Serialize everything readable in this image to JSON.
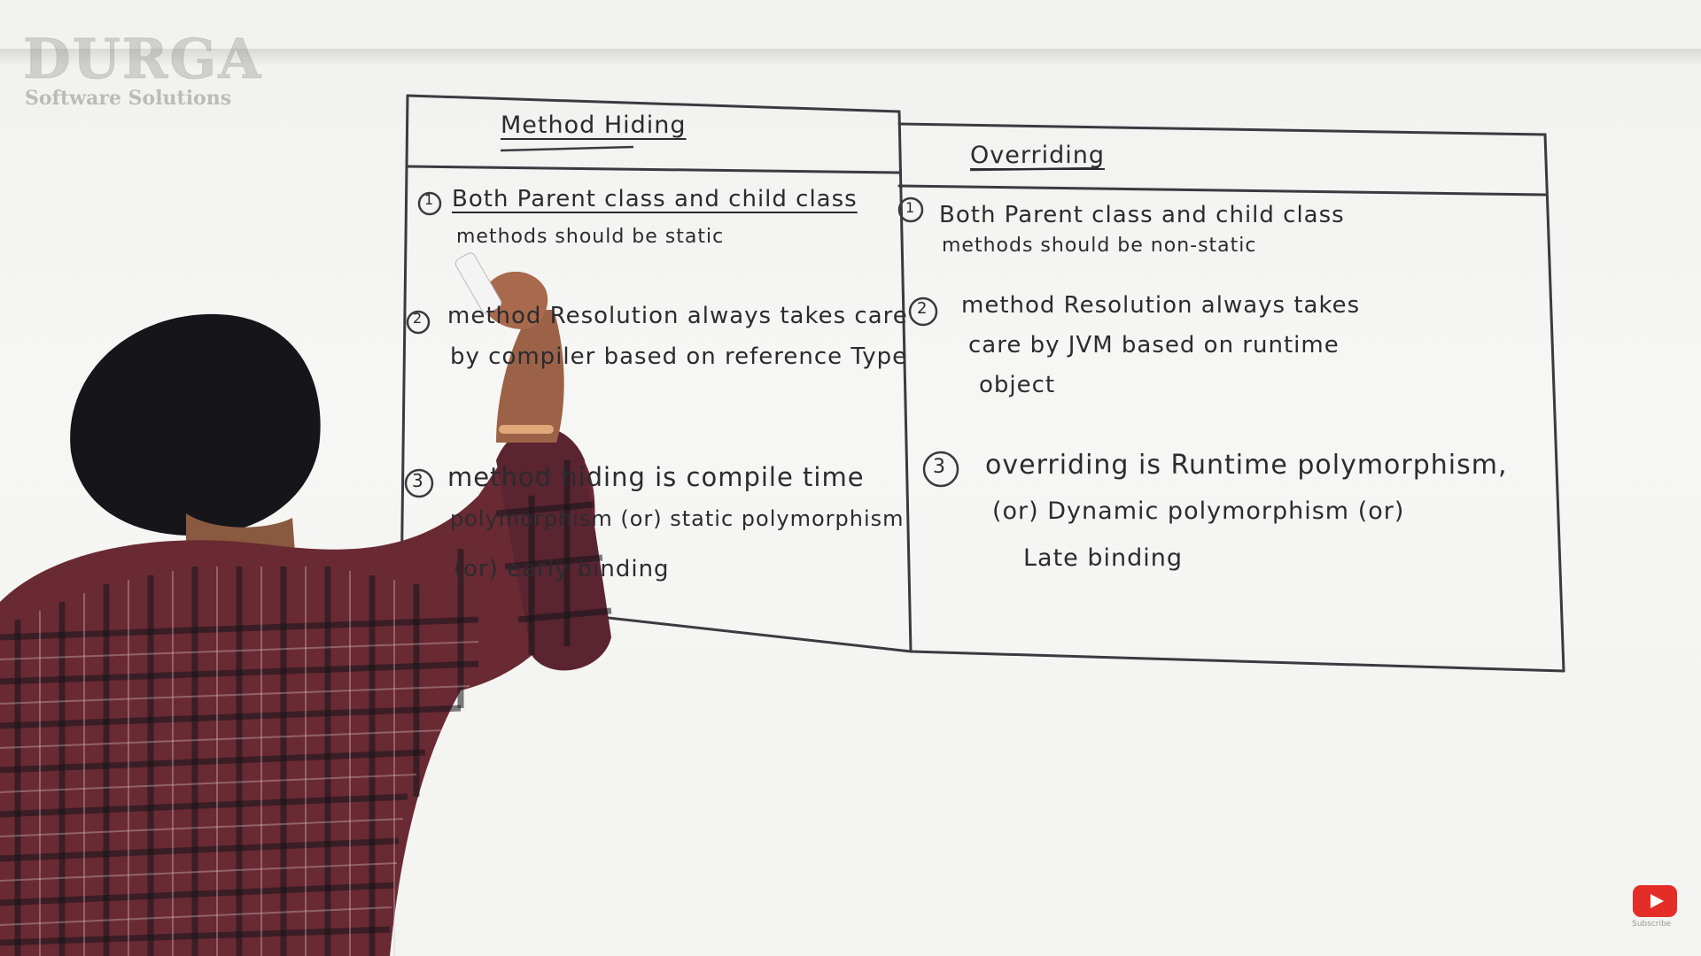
{
  "logo": {
    "name": "DURGA",
    "tagline": "Software Solutions"
  },
  "board": {
    "left_header": "Method Hiding",
    "right_header": "Overriding",
    "left_rows": [
      {
        "num": "1",
        "lines": [
          "Both Parent class and child class",
          "methods should be static"
        ]
      },
      {
        "num": "2",
        "lines": [
          "method Resolution always takes care",
          "by compiler based on reference Type"
        ]
      },
      {
        "num": "3",
        "lines": [
          "method hiding is compile time",
          "polymorphism (or) static polymorphism",
          "(or) early binding"
        ]
      }
    ],
    "right_rows": [
      {
        "num": "1",
        "lines": [
          "Both Parent class and child class",
          "methods should be non-static"
        ]
      },
      {
        "num": "2",
        "lines": [
          "method Resolution always takes",
          "care by JVM based on runtime",
          "object"
        ]
      },
      {
        "num": "3",
        "lines": [
          "overriding is Runtime polymorphism,",
          "(or) Dynamic polymorphism (or)",
          "Late binding"
        ]
      }
    ]
  },
  "youtube": {
    "label": "Subscribe"
  }
}
